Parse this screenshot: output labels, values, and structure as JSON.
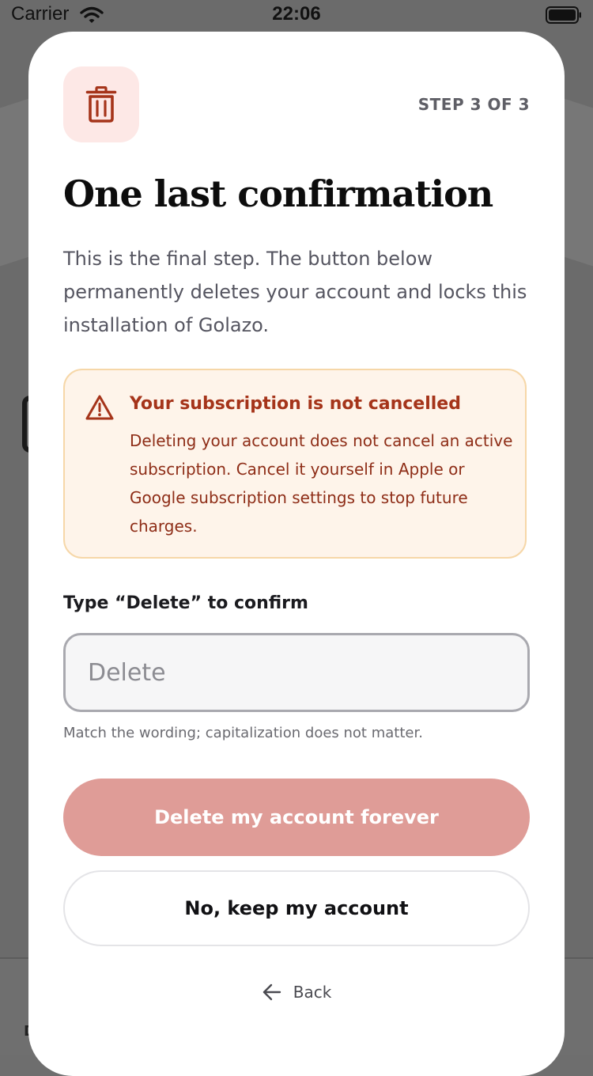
{
  "status_bar": {
    "carrier": "Carrier",
    "time": "22:06",
    "wifi_icon": "wifi-icon",
    "battery_icon": "battery-icon"
  },
  "background_app": {
    "tab_label": "D"
  },
  "sheet": {
    "icon": "trash-icon",
    "step": "STEP 3 OF 3",
    "title": "One last confirmation",
    "intro": "This is the final step. The button below permanently deletes your account and locks this installation of Golazo.",
    "warning": {
      "icon": "warning-triangle-icon",
      "title": "Your subscription is not cancelled",
      "body": "Deleting your account does not cancel an active subscription. Cancel it yourself in Apple or Google subscription settings to stop future charges."
    },
    "confirm": {
      "label": "Type “Delete” to confirm",
      "value": "",
      "placeholder": "Delete",
      "hint": "Match the wording; capitalization does not matter."
    },
    "delete_button": "Delete my account forever",
    "keep_button": "No, keep my account",
    "back": {
      "icon": "arrow-left-icon",
      "label": "Back"
    }
  },
  "colors": {
    "icon_tile_bg": "#fde8e6",
    "danger_icon": "#a5341a",
    "warning_bg": "#fef4ea",
    "warning_border": "#f6d7a8",
    "warning_text": "#a5341a",
    "delete_button_disabled": "#df9c97",
    "overlay": "#6b6b6b"
  }
}
